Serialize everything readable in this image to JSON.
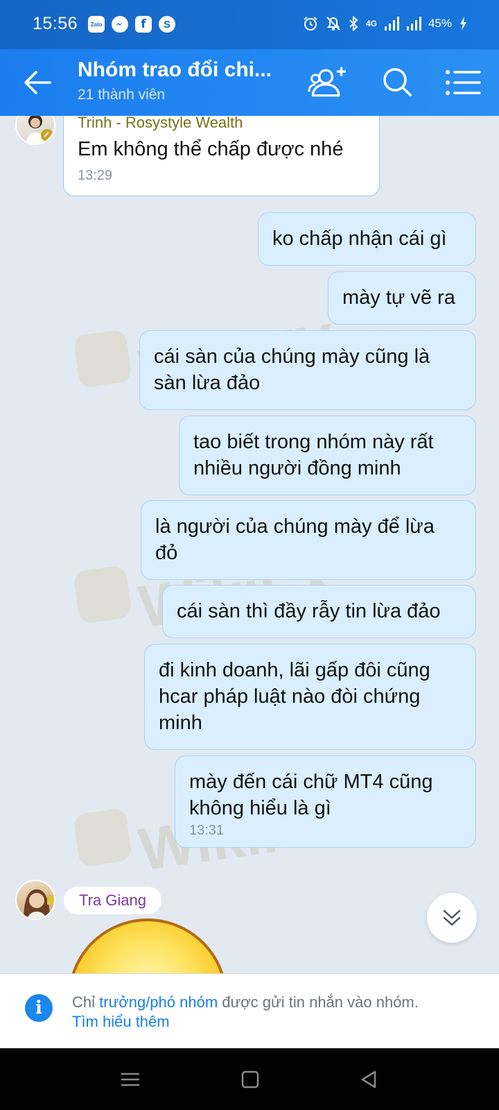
{
  "status_bar": {
    "time": "15:56",
    "apps": [
      "Zalo",
      "messenger",
      "f",
      "S"
    ],
    "network": "4G",
    "battery": "45%"
  },
  "header": {
    "title": "Nhóm trao đổi chi...",
    "member_count": "21 thành viên"
  },
  "messages": [
    {
      "sender": "Trinh - Rosystyle Wealth",
      "text": "Em không thể chấp được nhé",
      "time": "13:29",
      "direction": "in"
    },
    {
      "text": "ko chấp nhận cái gì",
      "direction": "out"
    },
    {
      "text": "mày tự vẽ ra",
      "direction": "out"
    },
    {
      "text": "cái sàn của chúng mày cũng là sàn lừa đảo",
      "direction": "out"
    },
    {
      "text": "tao biết trong nhóm này rất nhiều người đồng minh",
      "direction": "out"
    },
    {
      "text": "là người của chúng mày để lừa đỏ",
      "direction": "out"
    },
    {
      "text": "cái sàn thì đầy rẫy tin lừa đảo",
      "direction": "out"
    },
    {
      "text": "đi kinh doanh, lãi gấp đôi cũng hcar pháp luật nào đòi chứng minh",
      "direction": "out"
    },
    {
      "text": "mày đến cái chữ MT4 cũng không hiểu là gì",
      "time": "13:31",
      "direction": "out"
    }
  ],
  "next_sender": "Tra Giang",
  "notice": {
    "prefix": "Chỉ ",
    "link": "trưởng/phó nhóm",
    "suffix": " được gửi tin nhắn vào nhóm.",
    "learn_more": "Tìm hiểu thêm"
  },
  "watermark": "WikiFX",
  "colors": {
    "header": "#1b7df0",
    "outgoing_bubble": "#d9efff",
    "incoming_bubble": "#ffffff",
    "link": "#1a7fe5",
    "chat_background": "#e2e9f1"
  }
}
